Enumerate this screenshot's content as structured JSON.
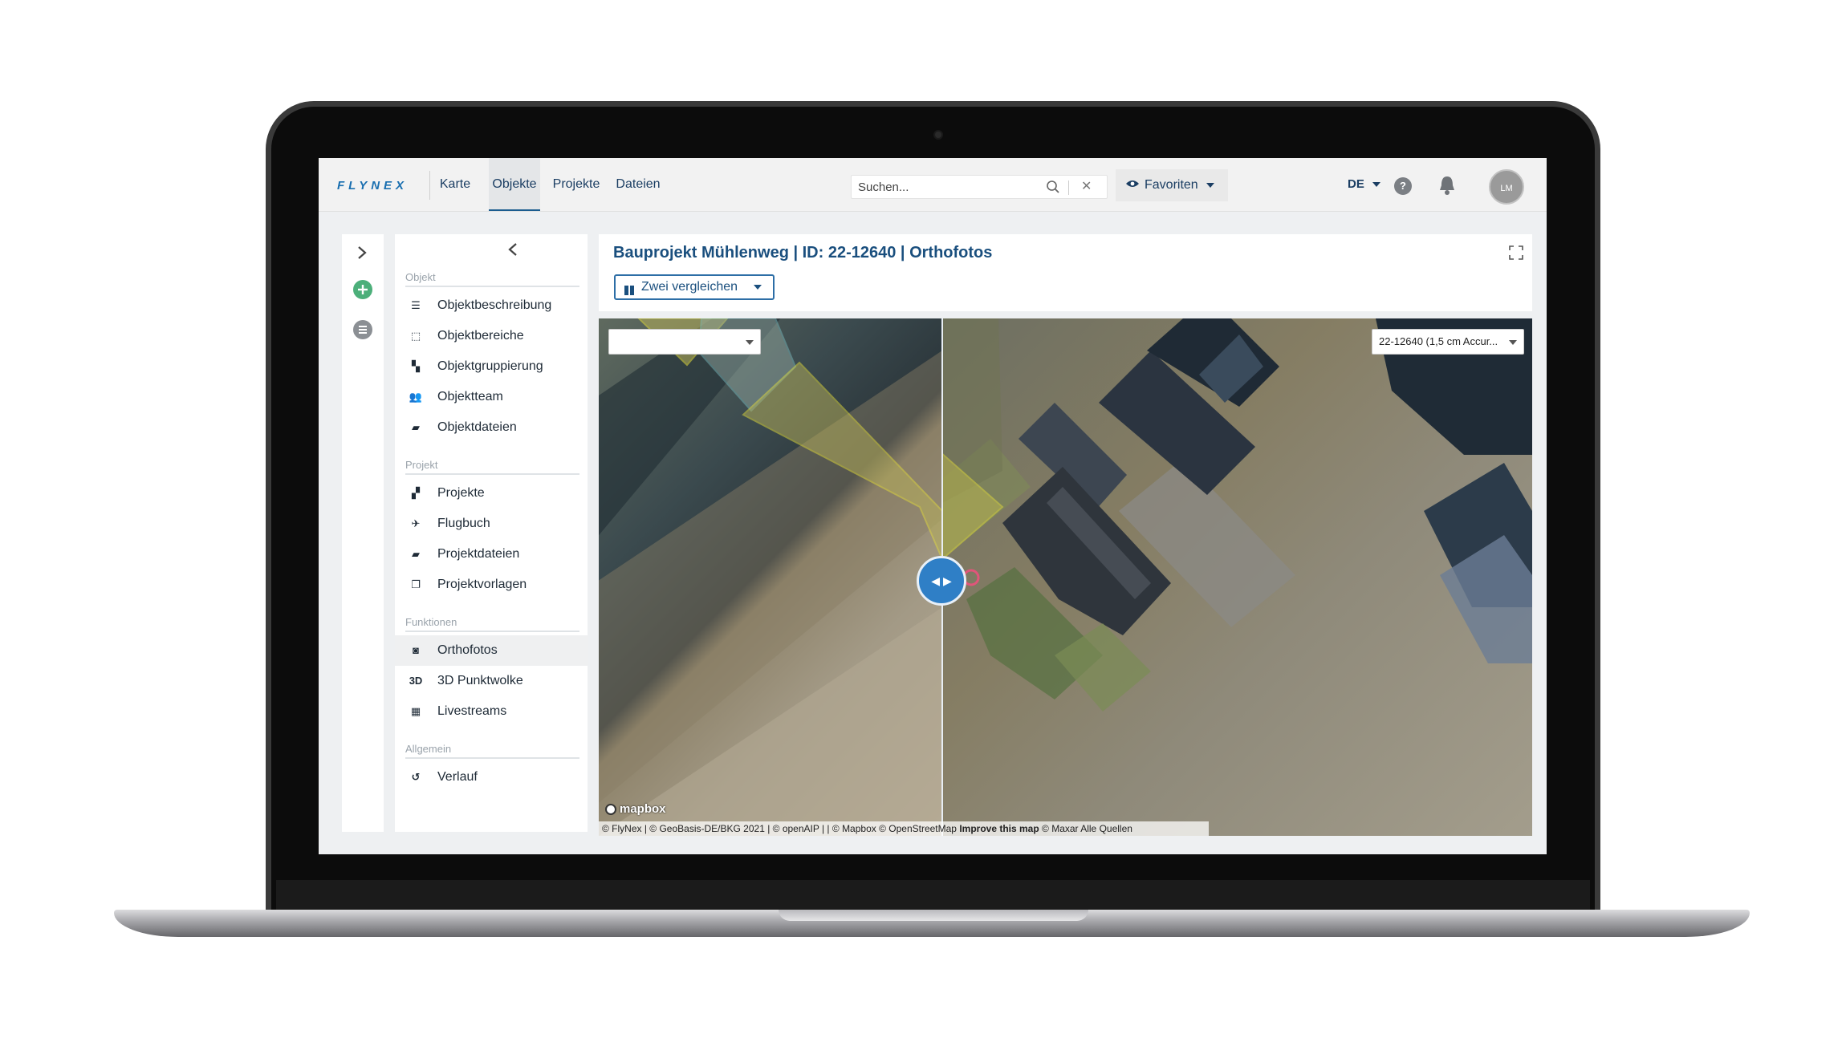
{
  "brand": {
    "logo": "FLYNEX"
  },
  "nav": {
    "tabs": [
      {
        "label": "Karte"
      },
      {
        "label": "Objekte"
      },
      {
        "label": "Projekte"
      },
      {
        "label": "Dateien"
      }
    ],
    "active_tab": "Objekte"
  },
  "search": {
    "placeholder": "Suchen..."
  },
  "favorites": {
    "label": "Favoriten"
  },
  "language": {
    "value": "DE"
  },
  "user": {
    "initials": "LM"
  },
  "sidemenu": {
    "sections": [
      {
        "title": "Objekt",
        "items": [
          {
            "label": "Objektbeschreibung",
            "icon": "list-icon"
          },
          {
            "label": "Objektbereiche",
            "icon": "area-select-icon"
          },
          {
            "label": "Objektgruppierung",
            "icon": "grouping-icon"
          },
          {
            "label": "Objektteam",
            "icon": "team-icon"
          },
          {
            "label": "Objektdateien",
            "icon": "folder-icon"
          }
        ]
      },
      {
        "title": "Projekt",
        "items": [
          {
            "label": "Projekte",
            "icon": "project-tree-icon"
          },
          {
            "label": "Flugbuch",
            "icon": "airplane-icon"
          },
          {
            "label": "Projektdateien",
            "icon": "folder-icon"
          },
          {
            "label": "Projektvorlagen",
            "icon": "template-icon"
          }
        ]
      },
      {
        "title": "Funktionen",
        "items": [
          {
            "label": "Orthofotos",
            "icon": "camera-icon"
          },
          {
            "label": "3D Punktwolke",
            "icon": "3d-icon"
          },
          {
            "label": "Livestreams",
            "icon": "film-icon"
          }
        ]
      },
      {
        "title": "Allgemein",
        "items": [
          {
            "label": "Verlauf",
            "icon": "history-icon"
          }
        ]
      }
    ],
    "active_item": "Orthofotos"
  },
  "content": {
    "title": "Bauprojekt Mühlenweg | ID: 22-12640 | Orthofotos",
    "compare_button": "Zwei vergleichen"
  },
  "map": {
    "left_select": "",
    "right_select": "22-12640 (1,5 cm Accur...",
    "mapbox_label": "mapbox",
    "attribution_prefix": "© FlyNex | © GeoBasis-DE/BKG 2021 | © openAIP | | © Mapbox © OpenStreetMap",
    "attribution_link": "Improve this map",
    "attribution_suffix": "© Maxar Alle Quellen"
  },
  "colors": {
    "accent": "#1a4f7e",
    "handle": "#2f7fc6",
    "add_green": "#4caf7a"
  }
}
